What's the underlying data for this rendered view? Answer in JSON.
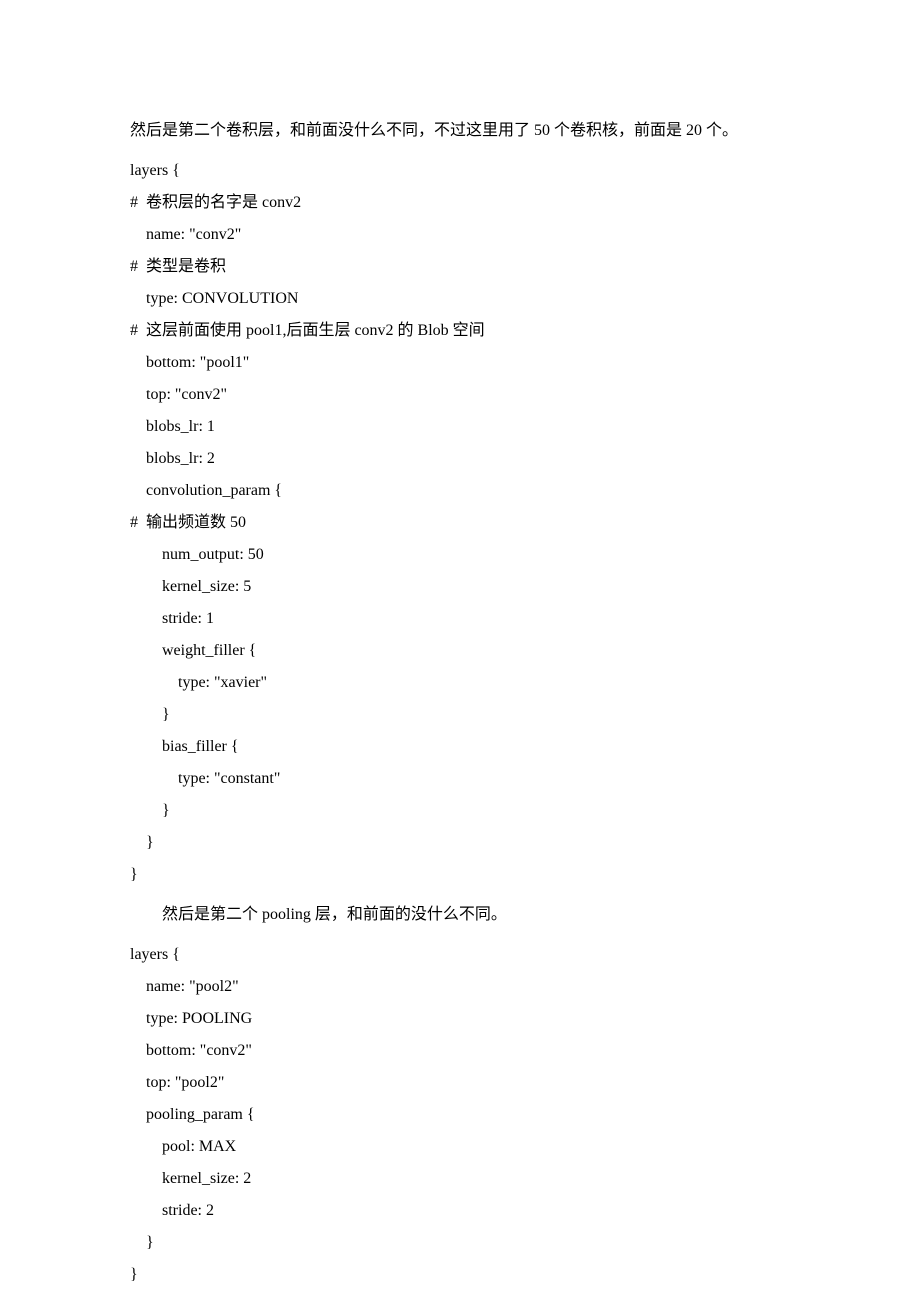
{
  "intro1": "然后是第二个卷积层，和前面没什么不同，不过这里用了 50 个卷积核，前面是 20 个。",
  "code1": "layers {\n#  卷积层的名字是 conv2\n    name: \"conv2\"\n#  类型是卷积\n    type: CONVOLUTION\n#  这层前面使用 pool1,后面生层 conv2 的 Blob 空间\n    bottom: \"pool1\"\n    top: \"conv2\"\n    blobs_lr: 1\n    blobs_lr: 2\n    convolution_param {\n#  输出频道数 50\n        num_output: 50\n        kernel_size: 5\n        stride: 1\n        weight_filler {\n            type: \"xavier\"\n        }\n        bias_filler {\n            type: \"constant\"\n        }\n    }\n}",
  "intro2": "然后是第二个 pooling 层，和前面的没什么不同。",
  "code2": "layers {\n    name: \"pool2\"\n    type: POOLING\n    bottom: \"conv2\"\n    top: \"pool2\"\n    pooling_param {\n        pool: MAX\n        kernel_size: 2\n        stride: 2\n    }\n}"
}
